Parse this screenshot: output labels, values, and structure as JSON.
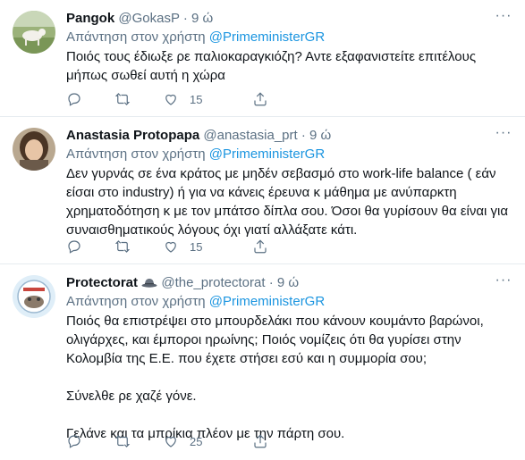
{
  "tweets": [
    {
      "name": "Pangok",
      "handle": "@GokasP",
      "time": "9 ώ",
      "reply_prefix": "Απάντηση στον χρήστη",
      "reply_mention": "@PrimeministerGR",
      "paragraphs": [
        "Ποιός τους έδιωξε ρε παλιοκαραγκιόζη? Αντε εξαφανιστείτε επιτέλους μήπως  σωθεί αυτή η χώρα"
      ],
      "likes": "15"
    },
    {
      "name": "Anastasia Protopapa",
      "handle": "@anastasia_prt",
      "time": "9 ώ",
      "reply_prefix": "Απάντηση στον χρήστη",
      "reply_mention": "@PrimeministerGR",
      "paragraphs": [
        "Δεν γυρνάς σε ένα κράτος με μηδέν σεβασμό στο work-life balance ( εάν είσαι στο industry) ή για να κάνεις έρευνα κ μάθημα με ανύπαρκτη χρηματοδότηση κ με τον μπάτσο δίπλα σου. Όσοι θα γυρίσουν θα είναι για συναισθηματικούς λόγους όχι γιατί αλλάξατε κάτι."
      ],
      "likes": "15"
    },
    {
      "name": "Protectorat",
      "handle": "@the_protectorat",
      "time": "9 ώ",
      "reply_prefix": "Απάντηση στον χρήστη",
      "reply_mention": "@PrimeministerGR",
      "paragraphs": [
        "Ποιός θα επιστρέψει στο μπουρδελάκι που κάνουν κουμάντο βαρώνοι, ολιγάρχες, και έμποροι ηρωίνης; Ποιός νομίζεις ότι θα γυρίσει στην Κολομβία της Ε.Ε. που έχετε στήσει εσύ και η συμμορία σου;",
        "Σύνελθε ρε χαζέ γόνε.",
        "Γελάνε και τα μπρίκια πλέον με την πάρτη σου."
      ],
      "likes": "25"
    }
  ],
  "icons": {
    "reply": "reply-icon",
    "retweet": "retweet-icon",
    "like": "heart-icon",
    "share": "share-icon",
    "more": "more-icon",
    "badge": "hat-badge-icon"
  },
  "colors": {
    "link": "#1b95e0",
    "muted": "#5b7083",
    "divider": "#e6ecf0"
  }
}
